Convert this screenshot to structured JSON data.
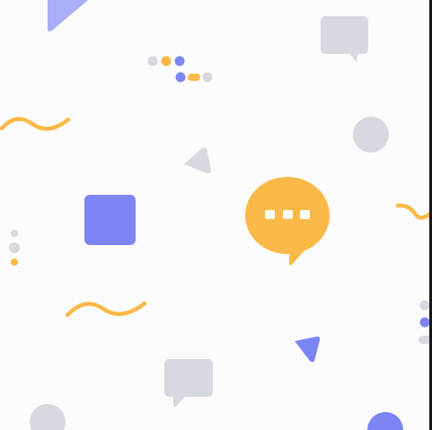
{
  "colors": {
    "background": "#fcfcfd",
    "gray": "#d7d9e1",
    "blue": "#7b86f4",
    "blue_light": "#a9aff7",
    "orange": "#fbb947",
    "white": "#ffffff",
    "edge": "#16161a"
  },
  "icons": {
    "main_bubble": "chat-bubble-typing-icon",
    "speech_bubbles": "speech-bubble-icon",
    "decorations": [
      "triangle",
      "square",
      "circle",
      "squiggle",
      "dots"
    ]
  }
}
